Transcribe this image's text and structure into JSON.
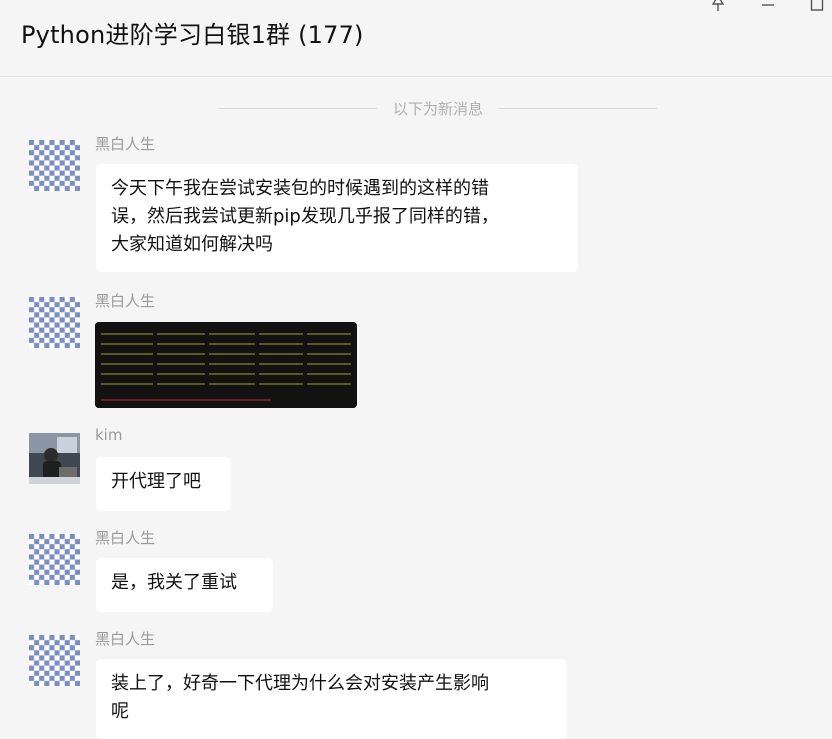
{
  "window": {
    "title": "Python进阶学习白银1群 (177)",
    "controls": [
      "pin-icon",
      "minimize-icon",
      "maximize-icon"
    ]
  },
  "divider_text": "以下为新消息",
  "colors": {
    "background": "#f5f5f5",
    "bubble": "#ffffff",
    "sender_name": "#9b9b9b",
    "avatar_pattern": "#7a8fbf"
  },
  "messages": [
    {
      "sender": "黑白人生",
      "avatar": "checker-avatar",
      "text_lines": [
        "今天下午我在尝试安装包的时候遇到的这样的错",
        "误，然后我尝试更新pip发现几乎报了同样的错，",
        "大家知道如何解决吗"
      ]
    },
    {
      "sender": "黑白人生",
      "avatar": "checker-avatar",
      "image": "terminal-error-screenshot"
    },
    {
      "sender": "kim",
      "avatar": "photo-avatar",
      "text_lines": [
        "开代理了吧"
      ]
    },
    {
      "sender": "黑白人生",
      "avatar": "checker-avatar",
      "text_lines": [
        "是，我关了重试"
      ]
    },
    {
      "sender": "黑白人生",
      "avatar": "checker-avatar",
      "text_lines": [
        "装上了，好奇一下代理为什么会对安装产生影响",
        "呢"
      ]
    }
  ]
}
